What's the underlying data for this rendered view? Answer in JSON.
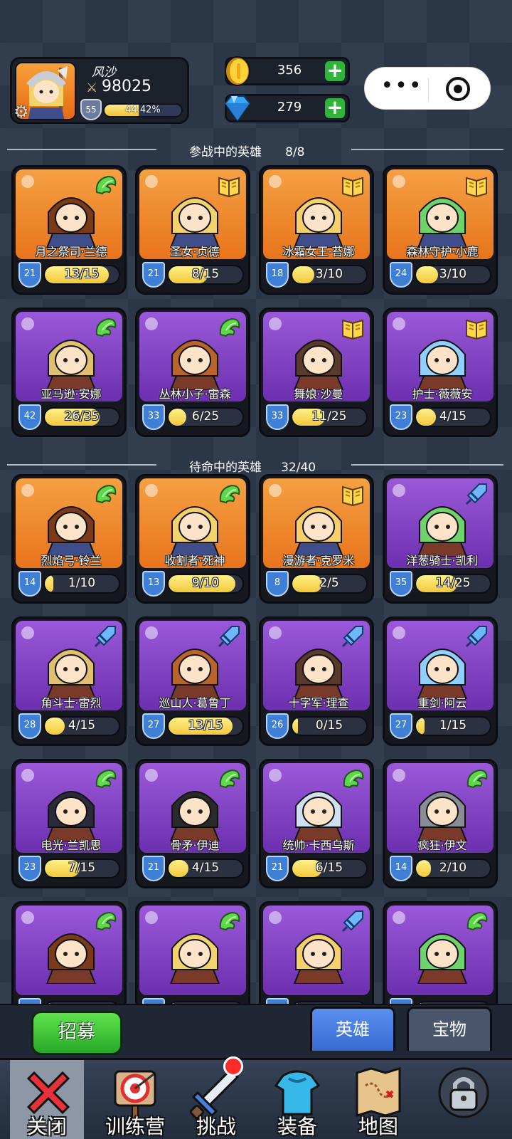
{
  "player": {
    "name": "风沙",
    "power": "98025",
    "level": "55",
    "exp_text": "44.42%",
    "exp_fraction": 0.4442
  },
  "currency": {
    "gold": "356",
    "gems": "279"
  },
  "capsule": {
    "more": "•••"
  },
  "active_section": {
    "title": "参战中的英雄",
    "count": "8/8"
  },
  "reserve_section": {
    "title": "待命中的英雄",
    "count": "32/40"
  },
  "active_heroes": [
    {
      "name": "月之祭司·兰德",
      "level": "21",
      "progress": "13/15",
      "fraction": 0.867,
      "bg": "orange",
      "badge": "wing-icon"
    },
    {
      "name": "圣女·贞德",
      "level": "21",
      "progress": "8/15",
      "fraction": 0.533,
      "bg": "orange",
      "badge": "book-icon"
    },
    {
      "name": "冰霜女王·苔娜",
      "level": "18",
      "progress": "3/10",
      "fraction": 0.3,
      "bg": "orange",
      "badge": "book-icon"
    },
    {
      "name": "森林守护·小鹿",
      "level": "24",
      "progress": "3/10",
      "fraction": 0.3,
      "bg": "orange",
      "badge": "book-icon"
    },
    {
      "name": "亚马逊·安娜",
      "level": "42",
      "progress": "26/35",
      "fraction": 0.743,
      "bg": "purple",
      "badge": "wing-icon"
    },
    {
      "name": "丛林小子·雷森",
      "level": "33",
      "progress": "6/25",
      "fraction": 0.24,
      "bg": "purple",
      "badge": "wing-icon"
    },
    {
      "name": "舞娘·沙曼",
      "level": "33",
      "progress": "11/25",
      "fraction": 0.44,
      "bg": "purple",
      "badge": "book-icon"
    },
    {
      "name": "护士·薇薇安",
      "level": "23",
      "progress": "4/15",
      "fraction": 0.267,
      "bg": "purple",
      "badge": "book-icon"
    }
  ],
  "reserve_heroes": [
    {
      "name": "烈焰弓·铃兰",
      "level": "14",
      "progress": "1/10",
      "fraction": 0.1,
      "bg": "orange",
      "badge": "wing-icon"
    },
    {
      "name": "收割者·死神",
      "level": "13",
      "progress": "9/10",
      "fraction": 0.9,
      "bg": "orange",
      "badge": "wing-icon"
    },
    {
      "name": "漫游者·克罗米",
      "level": "8",
      "progress": "2/5",
      "fraction": 0.4,
      "bg": "orange",
      "badge": "book-icon"
    },
    {
      "name": "洋葱骑士·凯利",
      "level": "35",
      "progress": "14/25",
      "fraction": 0.56,
      "bg": "purple",
      "badge": "sword-icon"
    },
    {
      "name": "角斗士·雷烈",
      "level": "28",
      "progress": "4/15",
      "fraction": 0.267,
      "bg": "purple",
      "badge": "sword-icon"
    },
    {
      "name": "巡山人·葛鲁丁",
      "level": "27",
      "progress": "13/15",
      "fraction": 0.867,
      "bg": "purple",
      "badge": "sword-icon"
    },
    {
      "name": "十字军·理查",
      "level": "26",
      "progress": "0/15",
      "fraction": 0.0,
      "bg": "purple",
      "badge": "sword-icon"
    },
    {
      "name": "重剑·阿云",
      "level": "27",
      "progress": "1/15",
      "fraction": 0.067,
      "bg": "purple",
      "badge": "sword-icon"
    },
    {
      "name": "电光·兰凯思",
      "level": "23",
      "progress": "7/15",
      "fraction": 0.467,
      "bg": "purple",
      "badge": "wing-icon"
    },
    {
      "name": "骨矛·伊迪",
      "level": "21",
      "progress": "4/15",
      "fraction": 0.267,
      "bg": "purple",
      "badge": "wing-icon"
    },
    {
      "name": "统帅·卡西乌斯",
      "level": "21",
      "progress": "6/15",
      "fraction": 0.4,
      "bg": "purple",
      "badge": "wing-icon"
    },
    {
      "name": "疯狂·伊文",
      "level": "14",
      "progress": "2/10",
      "fraction": 0.2,
      "bg": "purple",
      "badge": "wing-icon"
    },
    {
      "name": "",
      "level": "",
      "progress": "",
      "fraction": 0,
      "bg": "purple",
      "badge": "wing-icon"
    },
    {
      "name": "",
      "level": "",
      "progress": "",
      "fraction": 0,
      "bg": "purple",
      "badge": "wing-icon"
    },
    {
      "name": "",
      "level": "",
      "progress": "",
      "fraction": 0,
      "bg": "purple",
      "badge": "sword-icon"
    },
    {
      "name": "",
      "level": "",
      "progress": "",
      "fraction": 0,
      "bg": "purple",
      "badge": "wing-icon"
    }
  ],
  "actions": {
    "recruit": "招募",
    "tab_heroes": "英雄",
    "tab_treasure": "宝物"
  },
  "nav": [
    {
      "label": "关闭",
      "icon": "close-icon"
    },
    {
      "label": "训练营",
      "icon": "target-icon"
    },
    {
      "label": "挑战",
      "icon": "sword-icon"
    },
    {
      "label": "装备",
      "icon": "armor-icon"
    },
    {
      "label": "地图",
      "icon": "map-icon"
    },
    {
      "label": "",
      "icon": "lock-icon"
    }
  ],
  "colors": {
    "background": "#2b3747",
    "orange_card": "#f08a2e",
    "purple_card": "#8546c8",
    "progress_fill": "#f1c93a",
    "level_badge": "#3f7fd6",
    "plus_button": "#2fb43a",
    "recruit_button": "#3cc638",
    "tab_active": "#4a7de0"
  }
}
